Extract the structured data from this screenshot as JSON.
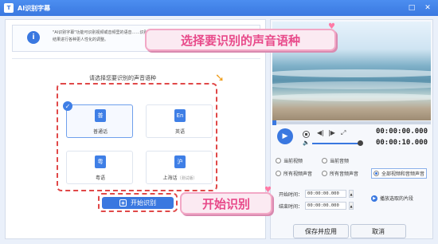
{
  "window": {
    "title": "AI识别字幕",
    "app_icon": "T"
  },
  "info": {
    "text": "\"AI识别字幕\"功能可识别视频或音频里的语音……识别结果进行各种更人性化的调整。"
  },
  "language": {
    "title": "请选择您要识别的声音语种",
    "options": [
      {
        "icon": "普",
        "label": "普通话",
        "selected": true
      },
      {
        "icon": "En",
        "label": "英语",
        "selected": false
      },
      {
        "icon": "粤",
        "label": "粤语",
        "selected": false
      },
      {
        "icon": "沪",
        "label": "上海话",
        "tag": "（测试版）",
        "selected": false
      }
    ]
  },
  "start_button": {
    "label": "开始识别"
  },
  "banners": {
    "select_language": "选择要识别的声音语种",
    "start_recognition": "开始识别"
  },
  "player": {
    "current_time": "00:00:00.000",
    "total_time": "00:00:10.000",
    "volume_percent": 85
  },
  "scope_options": [
    {
      "label": "当前视频",
      "selected": false
    },
    {
      "label": "当前音频",
      "selected": false
    },
    {
      "label": "所有视频声音",
      "selected": false
    },
    {
      "label": "所有音频声音",
      "selected": false
    },
    {
      "label": "全部视频和音频声音",
      "selected": true
    }
  ],
  "time_range": {
    "start_label": "开始时间：",
    "start_value": "00:00:00.000",
    "end_label": "结束时间：",
    "end_value": "00:00:00.000",
    "play_selection_label": "播放选取的片段"
  },
  "footer": {
    "save_label": "保存并应用",
    "cancel_label": "取消"
  },
  "colors": {
    "accent": "#3a78e0",
    "highlight_border": "#e04848",
    "banner_text": "#e84a8a"
  }
}
